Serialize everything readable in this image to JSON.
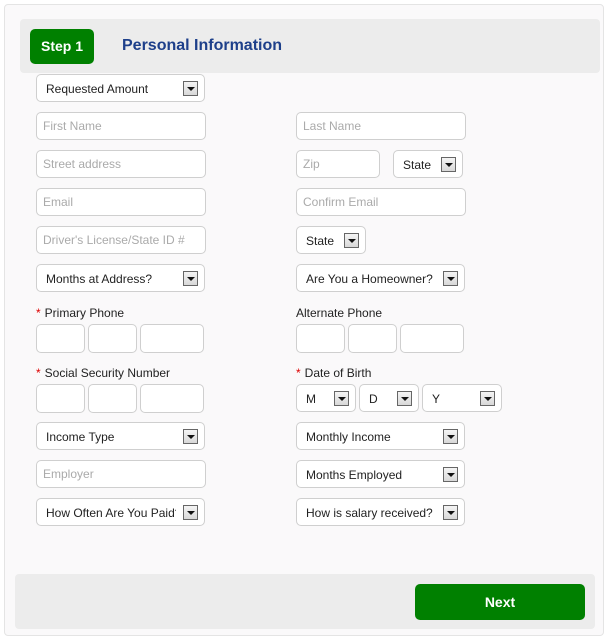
{
  "header": {
    "step_label": "Step 1",
    "title": "Personal Information"
  },
  "fields": {
    "requested_amount": "Requested Amount",
    "first_name_placeholder": "First Name",
    "last_name_placeholder": "Last Name",
    "street_placeholder": "Street address",
    "zip_placeholder": "Zip",
    "state_address": "State",
    "email_placeholder": "Email",
    "confirm_email_placeholder": "Confirm Email",
    "license_placeholder": "Driver's License/State ID #",
    "state_license": "State",
    "months_at_address": "Months at Address?",
    "homeowner": "Are You a Homeowner?",
    "primary_phone_label": "Primary Phone",
    "alternate_phone_label": "Alternate Phone",
    "ssn_label": "Social Security Number",
    "dob_label": "Date of Birth",
    "dob_month": "M",
    "dob_day": "D",
    "dob_year": "Y",
    "income_type": "Income Type",
    "monthly_income": "Monthly Income",
    "employer_placeholder": "Employer",
    "months_employed": "Months Employed",
    "pay_frequency": "How Often Are You Paid?",
    "salary_received": "How is salary received?",
    "required_mark": "*"
  },
  "footer": {
    "next_label": "Next"
  },
  "colors": {
    "accent_green": "#008000",
    "title_blue": "#1d3f8a",
    "required_red": "#dd0000"
  }
}
